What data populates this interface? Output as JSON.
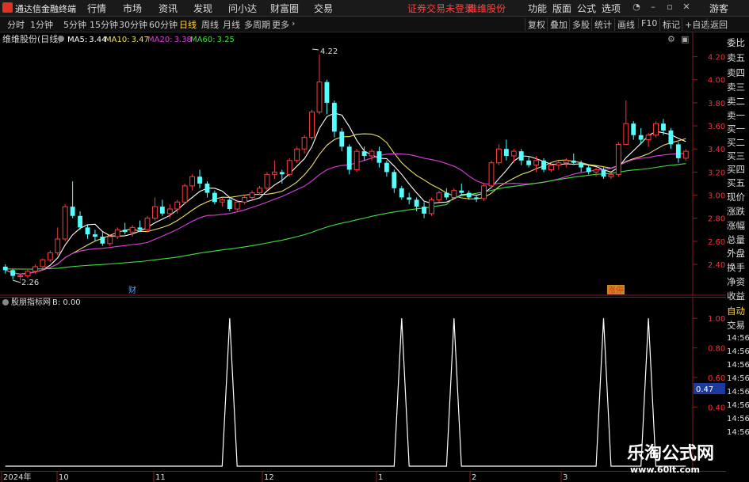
{
  "app": {
    "title": "通达信金融终端",
    "menu": [
      "行情",
      "市场",
      "资讯",
      "发现",
      "问小达",
      "财富圈",
      "交易"
    ],
    "login_warning": "证券交易未登录",
    "stock_name": "维维股份",
    "right_menu": [
      "功能",
      "版面",
      "公式",
      "选项"
    ],
    "guest": "游客"
  },
  "toolbar": {
    "periods": [
      "分时",
      "1分钟",
      "5分钟",
      "15分钟",
      "30分钟",
      "60分钟",
      "日线",
      "周线",
      "月线",
      "多周期",
      "更多"
    ],
    "active_period": "日线",
    "tools": [
      "复权",
      "叠加",
      "多股",
      "统计",
      "画线",
      "F10",
      "标记",
      "+自选",
      "返回"
    ]
  },
  "main_chart": {
    "stock_label": "维维股份(日线)",
    "ma": [
      {
        "label": "MA5:",
        "value": "3.44",
        "color": "#ffffff"
      },
      {
        "label": "MA10:",
        "value": "3.47",
        "color": "#f0e060"
      },
      {
        "label": "MA20:",
        "value": "3.38",
        "color": "#e040e0"
      },
      {
        "label": "MA60:",
        "value": "3.25",
        "color": "#40e040"
      }
    ],
    "high_mark": "4.22",
    "low_mark": "2.26",
    "events": [
      "财",
      "涨停"
    ]
  },
  "indicator": {
    "name": "股朋指标网",
    "value_label": "B: 0.00",
    "current_value": "0.47"
  },
  "side_panel": {
    "upper": [
      "委比",
      "卖五",
      "卖四",
      "卖三",
      "卖二",
      "卖一",
      "买一",
      "买二",
      "买三",
      "买四",
      "买五",
      "现价",
      "涨跌",
      "涨幅",
      "总量",
      "外盘",
      "换手",
      "净资",
      "收益"
    ],
    "auto": "自动",
    "trade": "交易",
    "times": [
      "14:56",
      "14:56",
      "14:56",
      "14:56",
      "14:56",
      "14:56",
      "14:56",
      "14:56"
    ]
  },
  "watermark": {
    "title": "乐淘公式网",
    "url": "www.60lt.com"
  },
  "chart_data": [
    {
      "type": "candlestick",
      "y_ticks": [
        "4.20",
        "4.00",
        "3.80",
        "3.60",
        "3.40",
        "3.20",
        "3.00",
        "2.80",
        "2.60",
        "2.40"
      ],
      "ylim": [
        2.16,
        4.3
      ],
      "x_labels": [
        "2024年",
        "10",
        "11",
        "12",
        "1",
        "2",
        "3"
      ],
      "candles": [
        [
          2.38,
          2.4,
          2.32,
          2.35
        ],
        [
          2.35,
          2.36,
          2.27,
          2.3
        ],
        [
          2.3,
          2.32,
          2.26,
          2.3
        ],
        [
          2.3,
          2.36,
          2.28,
          2.34
        ],
        [
          2.34,
          2.4,
          2.32,
          2.38
        ],
        [
          2.38,
          2.45,
          2.36,
          2.44
        ],
        [
          2.44,
          2.52,
          2.42,
          2.5
        ],
        [
          2.5,
          2.72,
          2.48,
          2.62
        ],
        [
          2.62,
          2.92,
          2.6,
          2.9
        ],
        [
          2.9,
          3.12,
          2.8,
          2.82
        ],
        [
          2.82,
          2.86,
          2.7,
          2.72
        ],
        [
          2.72,
          2.74,
          2.62,
          2.66
        ],
        [
          2.66,
          2.7,
          2.6,
          2.64
        ],
        [
          2.64,
          2.68,
          2.56,
          2.58
        ],
        [
          2.58,
          2.66,
          2.56,
          2.64
        ],
        [
          2.64,
          2.72,
          2.62,
          2.7
        ],
        [
          2.7,
          2.76,
          2.66,
          2.68
        ],
        [
          2.68,
          2.74,
          2.64,
          2.72
        ],
        [
          2.72,
          2.78,
          2.68,
          2.7
        ],
        [
          2.7,
          2.82,
          2.68,
          2.8
        ],
        [
          2.8,
          2.98,
          2.78,
          2.9
        ],
        [
          2.9,
          2.96,
          2.82,
          2.84
        ],
        [
          2.84,
          2.92,
          2.8,
          2.88
        ],
        [
          2.88,
          2.96,
          2.84,
          2.94
        ],
        [
          2.94,
          3.1,
          2.92,
          3.08
        ],
        [
          3.08,
          3.18,
          3.04,
          3.16
        ],
        [
          3.16,
          3.22,
          3.06,
          3.1
        ],
        [
          3.1,
          3.12,
          2.98,
          3.02
        ],
        [
          3.02,
          3.04,
          2.92,
          2.94
        ],
        [
          2.94,
          2.98,
          2.9,
          2.96
        ],
        [
          2.96,
          2.98,
          2.86,
          2.88
        ],
        [
          2.88,
          2.96,
          2.86,
          2.94
        ],
        [
          2.94,
          3.0,
          2.92,
          2.98
        ],
        [
          2.98,
          3.04,
          2.96,
          3.02
        ],
        [
          3.02,
          3.08,
          3.0,
          3.06
        ],
        [
          3.06,
          3.2,
          3.04,
          3.18
        ],
        [
          3.18,
          3.3,
          3.14,
          3.2
        ],
        [
          3.2,
          3.22,
          3.1,
          3.18
        ],
        [
          3.18,
          3.32,
          3.16,
          3.3
        ],
        [
          3.3,
          3.42,
          3.28,
          3.4
        ],
        [
          3.4,
          3.52,
          3.36,
          3.5
        ],
        [
          3.5,
          3.74,
          3.48,
          3.72
        ],
        [
          3.72,
          4.22,
          3.7,
          3.98
        ],
        [
          3.98,
          4.0,
          3.7,
          3.8
        ],
        [
          3.8,
          3.82,
          3.5,
          3.55
        ],
        [
          3.55,
          3.58,
          3.38,
          3.42
        ],
        [
          3.42,
          3.44,
          3.18,
          3.22
        ],
        [
          3.22,
          3.4,
          3.2,
          3.38
        ],
        [
          3.38,
          3.42,
          3.3,
          3.34
        ],
        [
          3.34,
          3.4,
          3.3,
          3.38
        ],
        [
          3.38,
          3.42,
          3.24,
          3.28
        ],
        [
          3.28,
          3.3,
          3.16,
          3.2
        ],
        [
          3.2,
          3.22,
          3.02,
          3.06
        ],
        [
          3.06,
          3.08,
          2.96,
          2.98
        ],
        [
          2.98,
          3.02,
          2.92,
          2.96
        ],
        [
          2.96,
          2.98,
          2.86,
          2.9
        ],
        [
          2.9,
          2.94,
          2.8,
          2.84
        ],
        [
          2.84,
          2.98,
          2.82,
          2.96
        ],
        [
          2.96,
          3.04,
          2.94,
          3.02
        ],
        [
          3.02,
          3.06,
          2.96,
          2.98
        ],
        [
          2.98,
          3.06,
          2.96,
          3.04
        ],
        [
          3.04,
          3.1,
          3.0,
          3.02
        ],
        [
          3.02,
          3.04,
          2.96,
          2.98
        ],
        [
          2.98,
          3.0,
          2.94,
          2.97
        ],
        [
          2.97,
          3.1,
          2.95,
          3.08
        ],
        [
          3.08,
          3.3,
          3.06,
          3.28
        ],
        [
          3.28,
          3.44,
          3.26,
          3.4
        ],
        [
          3.4,
          3.48,
          3.3,
          3.34
        ],
        [
          3.34,
          3.4,
          3.28,
          3.38
        ],
        [
          3.38,
          3.4,
          3.26,
          3.3
        ],
        [
          3.3,
          3.34,
          3.24,
          3.26
        ],
        [
          3.26,
          3.34,
          3.2,
          3.3
        ],
        [
          3.3,
          3.32,
          3.2,
          3.22
        ],
        [
          3.22,
          3.28,
          3.2,
          3.26
        ],
        [
          3.26,
          3.3,
          3.22,
          3.28
        ],
        [
          3.28,
          3.32,
          3.24,
          3.3
        ],
        [
          3.3,
          3.36,
          3.26,
          3.28
        ],
        [
          3.28,
          3.3,
          3.2,
          3.24
        ],
        [
          3.24,
          3.26,
          3.18,
          3.2
        ],
        [
          3.2,
          3.24,
          3.16,
          3.22
        ],
        [
          3.22,
          3.24,
          3.14,
          3.16
        ],
        [
          3.16,
          3.2,
          3.14,
          3.18
        ],
        [
          3.18,
          3.46,
          3.16,
          3.44
        ],
        [
          3.44,
          3.82,
          3.5,
          3.62
        ],
        [
          3.62,
          3.64,
          3.48,
          3.52
        ],
        [
          3.52,
          3.58,
          3.44,
          3.48
        ],
        [
          3.48,
          3.54,
          3.42,
          3.52
        ],
        [
          3.52,
          3.64,
          3.5,
          3.62
        ],
        [
          3.62,
          3.66,
          3.52,
          3.56
        ],
        [
          3.56,
          3.58,
          3.4,
          3.44
        ],
        [
          3.44,
          3.46,
          3.28,
          3.32
        ],
        [
          3.32,
          3.4,
          3.3,
          3.38
        ]
      ],
      "ma_series": [
        {
          "name": "MA5",
          "color": "#ffffff"
        },
        {
          "name": "MA10",
          "color": "#f0e060"
        },
        {
          "name": "MA20",
          "color": "#e040e0"
        },
        {
          "name": "MA60",
          "color": "#40e040"
        }
      ]
    },
    {
      "type": "line",
      "y_ticks": [
        "1.00",
        "0.80",
        "0.60",
        "0.40"
      ],
      "ylim": [
        0,
        1.06
      ],
      "spikes": [
        30,
        53,
        60,
        80,
        86
      ],
      "n": 92,
      "color": "#ffffff"
    }
  ]
}
